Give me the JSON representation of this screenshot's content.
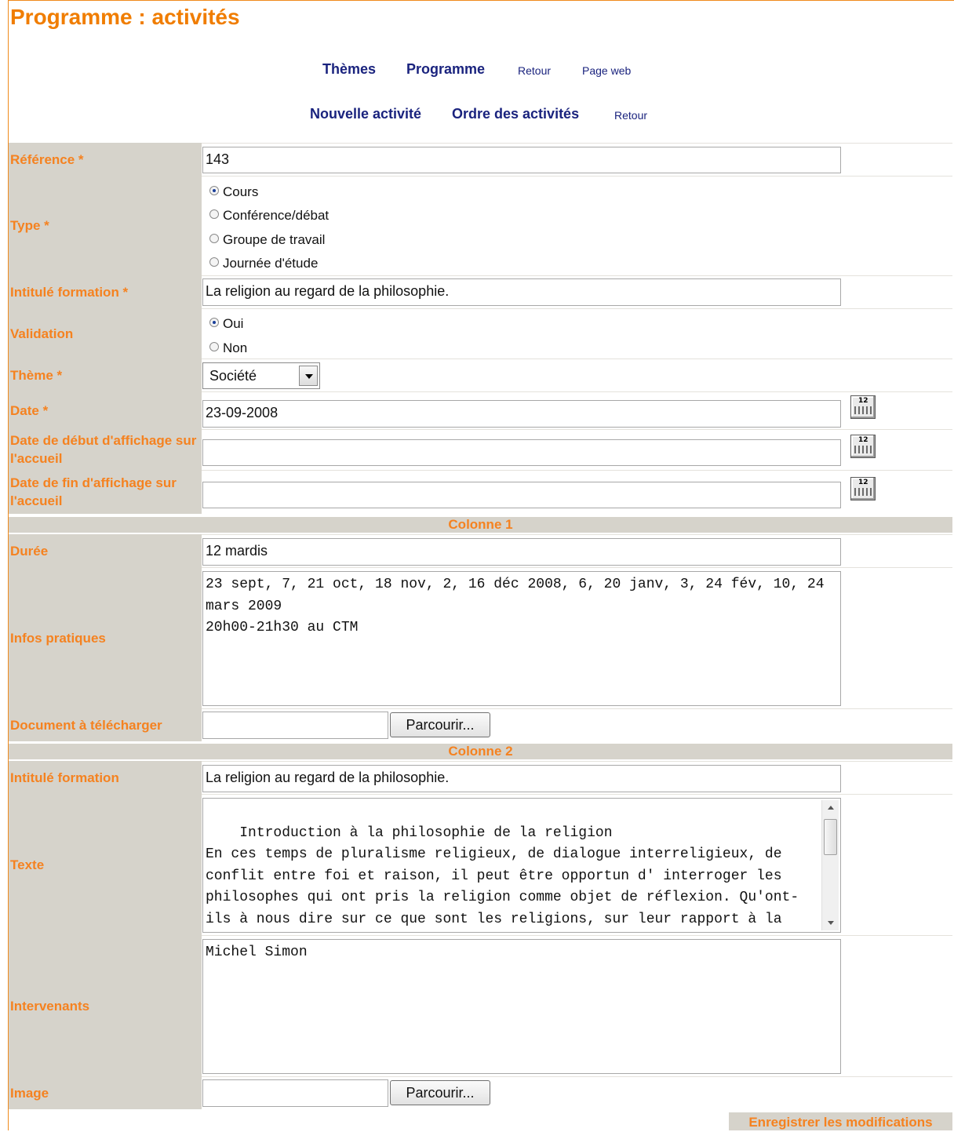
{
  "page": {
    "title": "Programme : activités"
  },
  "nav_top": {
    "themes": "Thèmes",
    "programme": "Programme",
    "retour": "Retour",
    "page_web": "Page web"
  },
  "nav_sub": {
    "nouvelle": "Nouvelle activité",
    "ordre": "Ordre des activités",
    "retour": "Retour"
  },
  "form": {
    "reference": {
      "label": "Référence *",
      "value": "143"
    },
    "type": {
      "label": "Type *",
      "options": [
        "Cours",
        "Conférence/débat",
        "Groupe de travail",
        "Journée d'étude"
      ],
      "selected": "Cours"
    },
    "intitule": {
      "label": "Intitulé formation *",
      "value": "La religion au regard de la philosophie."
    },
    "validation": {
      "label": "Validation",
      "options": [
        "Oui",
        "Non"
      ],
      "selected": "Oui"
    },
    "theme": {
      "label": "Thème *",
      "value": "Société"
    },
    "date": {
      "label": "Date *",
      "value": "23-09-2008"
    },
    "date_debut": {
      "label": "Date de début d'affichage sur l'accueil",
      "value": ""
    },
    "date_fin": {
      "label": "Date de fin d'affichage sur l'accueil",
      "value": ""
    },
    "colonne1": "Colonne 1",
    "duree": {
      "label": "Durée",
      "value": "12 mardis"
    },
    "infos": {
      "label": "Infos pratiques",
      "value": "23 sept, 7, 21 oct, 18 nov, 2, 16 déc 2008, 6, 20 janv, 3, 24 fév, 10, 24 mars 2009\n20h00-21h30 au CTM"
    },
    "document": {
      "label": "Document à télécharger",
      "button": "Parcourir..."
    },
    "colonne2": "Colonne 2",
    "intitule2": {
      "label": "Intitulé formation",
      "value": "La religion au regard de la philosophie."
    },
    "texte": {
      "label": "Texte",
      "value": "Introduction à la philosophie de la religion\nEn ces temps de pluralisme religieux, de dialogue interreligieux, de conflit entre foi et raison, il peut être opportun d' interroger les philosophes qui ont pris la religion comme objet de réflexion. Qu'ont-ils à nous dire sur ce que sont les religions, sur leur rapport à la vérité,"
    },
    "intervenants": {
      "label": "Intervenants",
      "value": "Michel Simon"
    },
    "image": {
      "label": "Image",
      "button": "Parcourir..."
    },
    "save": "Enregistrer les modifications"
  }
}
